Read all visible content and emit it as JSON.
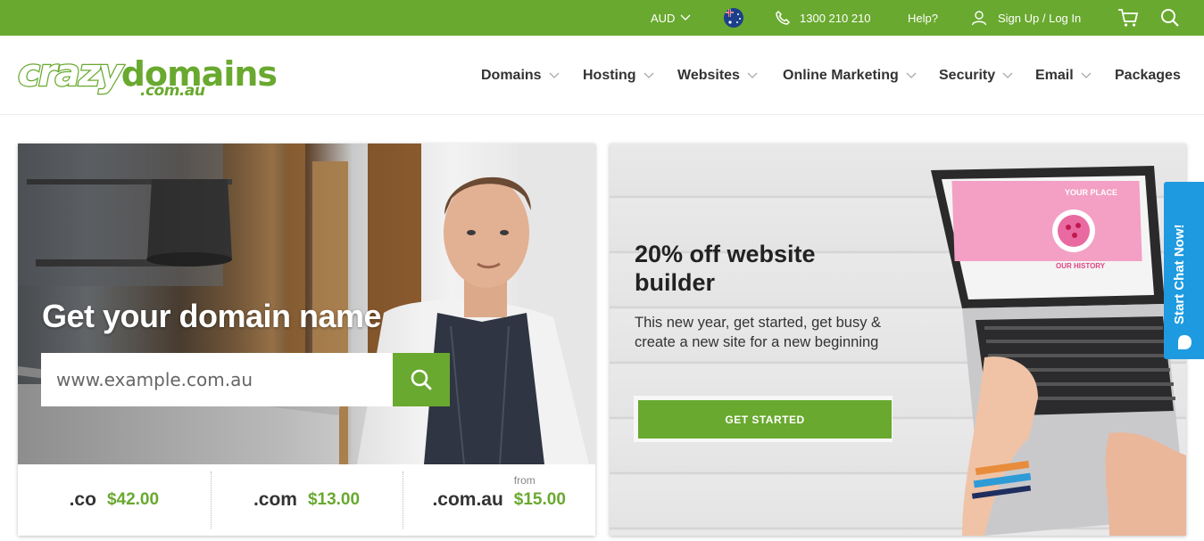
{
  "topbar": {
    "currency": "AUD",
    "phone": "1300 210 210",
    "help": "Help?",
    "account": "Sign Up / Log In"
  },
  "logo": {
    "main_left": "crazy",
    "main_right": "domains",
    "sub": ".com.au"
  },
  "nav": [
    {
      "label": "Domains",
      "has_menu": true
    },
    {
      "label": "Hosting",
      "has_menu": true
    },
    {
      "label": "Websites",
      "has_menu": true
    },
    {
      "label": "Online Marketing",
      "has_menu": true
    },
    {
      "label": "Security",
      "has_menu": true
    },
    {
      "label": "Email",
      "has_menu": true
    },
    {
      "label": "Packages",
      "has_menu": false
    }
  ],
  "hero": {
    "title": "Get your domain name",
    "search_placeholder": "www.example.com.au",
    "prices": [
      {
        "tld": ".co",
        "price": "$42.00",
        "prefix": ""
      },
      {
        "tld": ".com",
        "price": "$13.00",
        "prefix": ""
      },
      {
        "tld": ".com.au",
        "price": "$15.00",
        "prefix": "from"
      }
    ]
  },
  "promo": {
    "title": "20% off website builder",
    "text": "This new year, get started, get busy & create a new site for a new beginning",
    "cta": "GET STARTED",
    "screen_heading": "YOUR PLACE",
    "screen_subheading": "OUR HISTORY"
  },
  "chat": {
    "label": "Start Chat Now!"
  },
  "colors": {
    "brand_green": "#69a92f",
    "chat_blue": "#1e9be0",
    "text_dark": "#333333"
  },
  "icons": [
    "chevron-down-icon",
    "australia-flag-icon",
    "phone-icon",
    "user-icon",
    "cart-icon",
    "search-icon",
    "chat-bubble-icon"
  ]
}
